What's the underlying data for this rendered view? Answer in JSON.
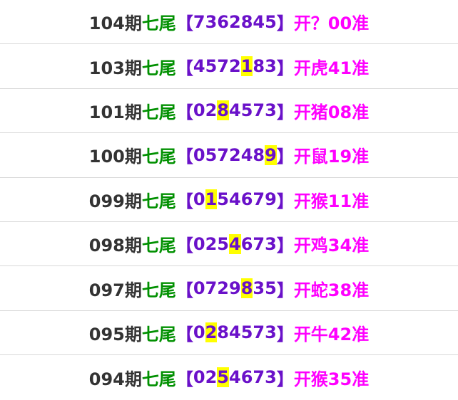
{
  "colors": {
    "period": "#333333",
    "label": "#009000",
    "bracket": "#6a11c9",
    "result": "#ff00ff",
    "highlight": "#ffff00",
    "divider": "#d9d9d9"
  },
  "rows": [
    {
      "period": "104期",
      "label": "七尾",
      "open": "【",
      "digits": [
        "7",
        "3",
        "6",
        "2",
        "8",
        "4",
        "5"
      ],
      "hit": -1,
      "close": "】",
      "result": "开？00准"
    },
    {
      "period": "103期",
      "label": "七尾",
      "open": "【",
      "digits": [
        "4",
        "5",
        "7",
        "2",
        "1",
        "8",
        "3"
      ],
      "hit": 4,
      "close": "】",
      "result": "开虎41准"
    },
    {
      "period": "101期",
      "label": "七尾",
      "open": "【",
      "digits": [
        "0",
        "2",
        "8",
        "4",
        "5",
        "7",
        "3"
      ],
      "hit": 2,
      "close": "】",
      "result": "开猪08准"
    },
    {
      "period": "100期",
      "label": "七尾",
      "open": "【",
      "digits": [
        "0",
        "5",
        "7",
        "2",
        "4",
        "8",
        "9"
      ],
      "hit": 6,
      "close": "】",
      "result": "开鼠19准"
    },
    {
      "period": "099期",
      "label": "七尾",
      "open": "【",
      "digits": [
        "0",
        "1",
        "5",
        "4",
        "6",
        "7",
        "9"
      ],
      "hit": 1,
      "close": "】",
      "result": "开猴11准"
    },
    {
      "period": "098期",
      "label": "七尾",
      "open": "【",
      "digits": [
        "0",
        "2",
        "5",
        "4",
        "6",
        "7",
        "3"
      ],
      "hit": 3,
      "close": "】",
      "result": "开鸡34准"
    },
    {
      "period": "097期",
      "label": "七尾",
      "open": "【",
      "digits": [
        "0",
        "7",
        "2",
        "9",
        "8",
        "3",
        "5"
      ],
      "hit": 4,
      "close": "】",
      "result": "开蛇38准"
    },
    {
      "period": "095期",
      "label": "七尾",
      "open": "【",
      "digits": [
        "0",
        "2",
        "8",
        "4",
        "5",
        "7",
        "3"
      ],
      "hit": 1,
      "close": "】",
      "result": "开牛42准"
    },
    {
      "period": "094期",
      "label": "七尾",
      "open": "【",
      "digits": [
        "0",
        "2",
        "5",
        "4",
        "6",
        "7",
        "3"
      ],
      "hit": 2,
      "close": "】",
      "result": "开猴35准"
    }
  ]
}
